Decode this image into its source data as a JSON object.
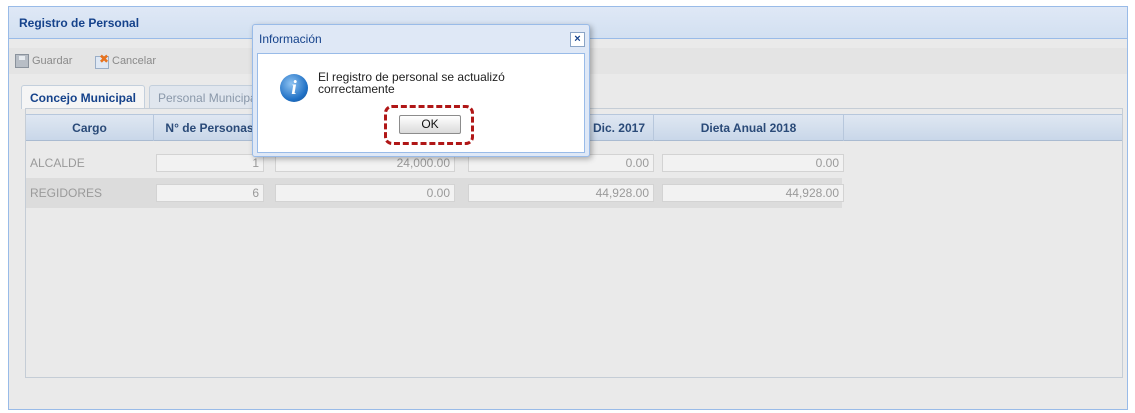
{
  "panel": {
    "title": "Registro de Personal"
  },
  "toolbar": {
    "save_label": "Guardar",
    "cancel_label": "Cancelar"
  },
  "tabs": [
    {
      "label": "Concejo Municipal"
    },
    {
      "label": "Personal Municipal"
    }
  ],
  "grid": {
    "columns": [
      "Cargo",
      "N° de Personas",
      "Dieta Anual Dic. 2017",
      "Dieta Anual 2018"
    ],
    "rows": [
      {
        "cargo": "ALCALDE",
        "personas": "1",
        "monto1": "24,000.00",
        "monto2": "0.00",
        "monto3": "0.00"
      },
      {
        "cargo": "REGIDORES",
        "personas": "6",
        "monto1": "0.00",
        "monto2": "44,928.00",
        "monto3": "44,928.00"
      }
    ]
  },
  "dialog": {
    "title": "Información",
    "close_symbol": "×",
    "message": "El registro de personal se actualizó correctamente",
    "ok_label": "OK",
    "icon": "info-icon"
  },
  "colors": {
    "header_text": "#15428b",
    "highlight": "#b01616"
  }
}
